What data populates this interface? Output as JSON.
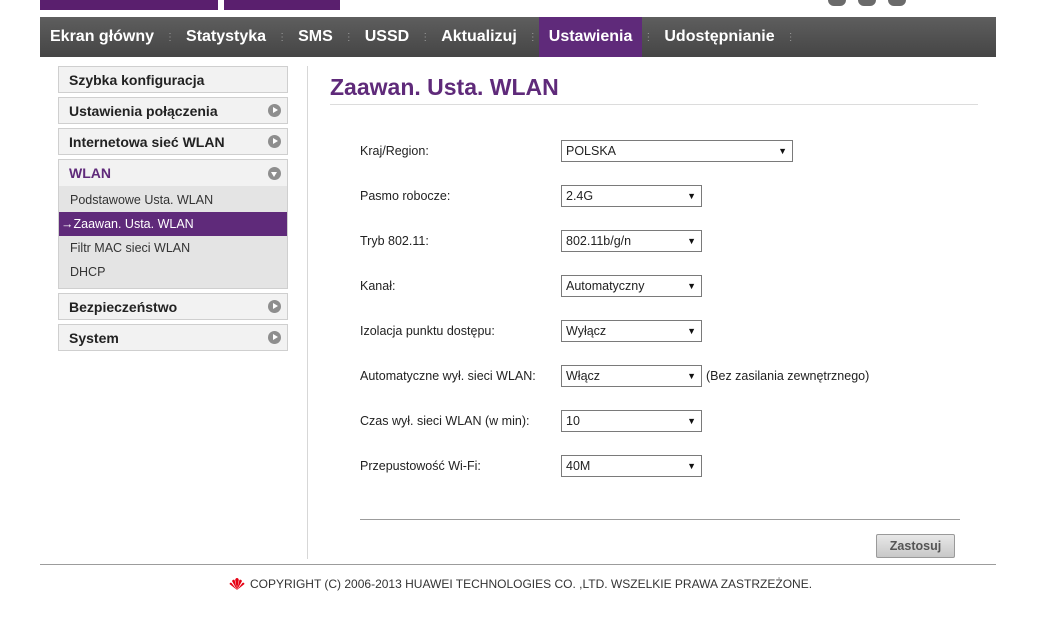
{
  "nav": {
    "tabs": [
      {
        "label": "Ekran główny"
      },
      {
        "label": "Statystyka"
      },
      {
        "label": "SMS"
      },
      {
        "label": "USSD"
      },
      {
        "label": "Aktualizuj"
      },
      {
        "label": "Ustawienia"
      },
      {
        "label": "Udostępnianie"
      }
    ],
    "active_tab": "Ustawienia"
  },
  "sidebar": {
    "items": [
      {
        "label": "Szybka konfiguracja"
      },
      {
        "label": "Ustawienia połączenia"
      },
      {
        "label": "Internetowa sieć WLAN"
      },
      {
        "label": "WLAN"
      },
      {
        "label": "Bezpieczeństwo"
      },
      {
        "label": "System"
      }
    ],
    "wlan_sub": [
      {
        "label": "Podstawowe Usta. WLAN"
      },
      {
        "label": "→Zaawan. Usta. WLAN"
      },
      {
        "label": "Filtr MAC sieci WLAN"
      },
      {
        "label": "DHCP"
      }
    ]
  },
  "main": {
    "title": "Zaawan. Usta. WLAN",
    "fields": [
      {
        "label": "Kraj/Region:",
        "value": "POLSKA"
      },
      {
        "label": "Pasmo robocze:",
        "value": "2.4G"
      },
      {
        "label": "Tryb 802.11:",
        "value": "802.11b/g/n"
      },
      {
        "label": "Kanał:",
        "value": "Automatyczny"
      },
      {
        "label": "Izolacja punktu dostępu:",
        "value": "Wyłącz"
      },
      {
        "label": "Automatyczne wył. sieci WLAN:",
        "value": "Włącz",
        "note": "(Bez zasilania zewnętrznego)"
      },
      {
        "label": "Czas wył. sieci WLAN (w min):",
        "value": "10"
      },
      {
        "label": "Przepustowość Wi-Fi:",
        "value": "40M"
      }
    ],
    "apply_label": "Zastosuj"
  },
  "footer": {
    "copyright": "COPYRIGHT (C) 2006-2013 HUAWEI TECHNOLOGIES CO. ,LTD. WSZELKIE PRAWA ZASTRZEŻONE."
  },
  "colors": {
    "accent": "#5f2a7a",
    "navbar": "#4f4f4f",
    "brand_logo": "#e60012"
  }
}
